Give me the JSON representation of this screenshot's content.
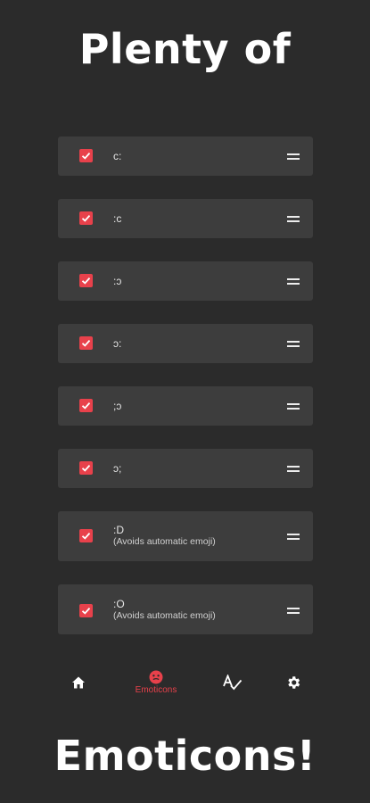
{
  "headline_top": "Plenty of",
  "headline_bottom": "Emoticons!",
  "accent_color": "#e8414b",
  "emoticons": [
    {
      "label": "c:",
      "checked": true
    },
    {
      "label": ":c",
      "checked": true
    },
    {
      "label": ":ɔ",
      "checked": true
    },
    {
      "label": "ɔ:",
      "checked": true
    },
    {
      "label": ";ɔ",
      "checked": true
    },
    {
      "label": "ɔ;",
      "checked": true
    },
    {
      "label": ":D",
      "note": "(Avoids automatic emoji)",
      "checked": true
    },
    {
      "label": ":O",
      "note": "(Avoids automatic emoji)",
      "checked": true
    }
  ],
  "nav": {
    "home_icon": "home-icon",
    "emoticons_icon": "emoticon-face-icon",
    "emoticons_label": "Emoticons",
    "spellcheck_icon": "spellcheck-icon",
    "settings_icon": "gear-icon"
  }
}
